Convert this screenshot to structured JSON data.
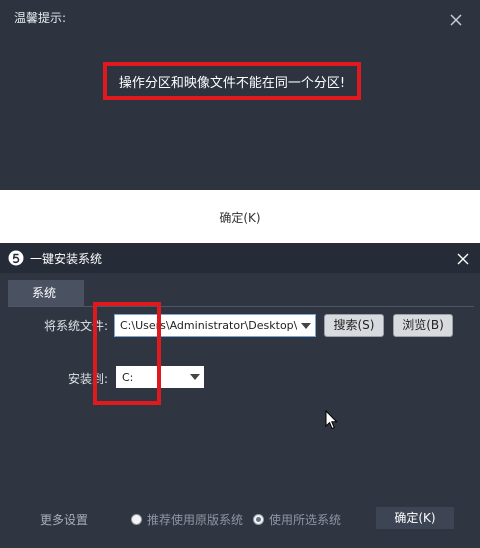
{
  "alert": {
    "title": "温馨提示:",
    "message": "操作分区和映像文件不能在同一个分区!",
    "ok_label": "确定(K)"
  },
  "installer": {
    "title": "一键安装系统",
    "tab_label": "系统",
    "image_file_label": "将系统文件:",
    "image_file_value": "C:\\Users\\Administrator\\Desktop\\W",
    "search_label": "搜索(S)",
    "browse_label": "浏览(B)",
    "install_to_label": "安装到:",
    "install_drive": "C:",
    "more_settings_label": "更多设置",
    "radio_options": [
      {
        "label": "推荐使用原版系统",
        "checked": false
      },
      {
        "label": "使用所选系统",
        "checked": true
      }
    ],
    "ok_label": "确定(K)"
  },
  "colors": {
    "dialog_bg": "#2d3440",
    "window_bg": "#2f3541",
    "highlight": "#e0191f"
  }
}
